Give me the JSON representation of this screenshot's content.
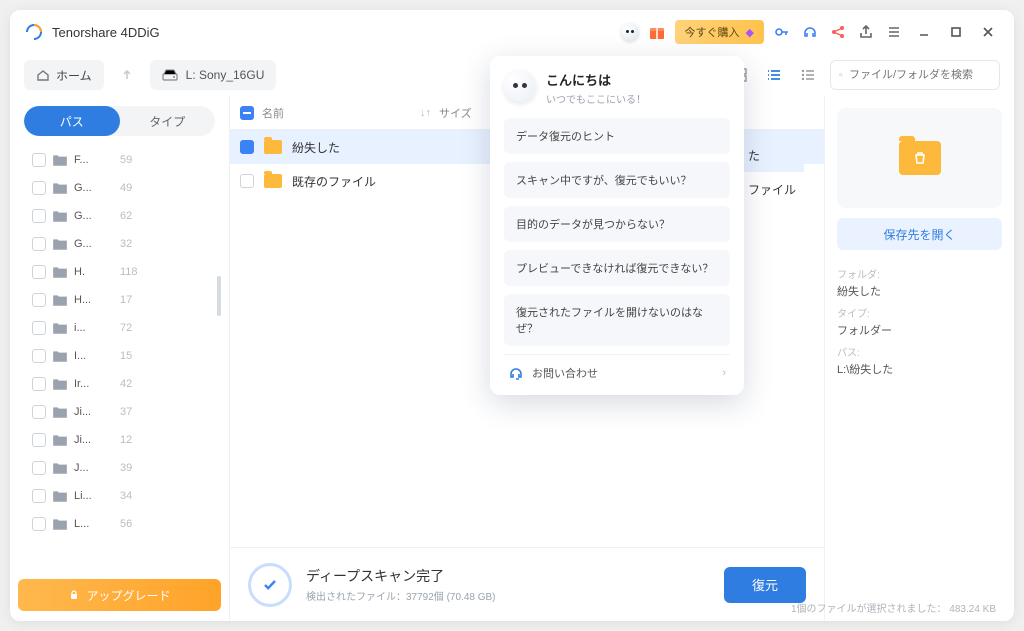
{
  "app": {
    "title": "Tenorshare 4DDiG"
  },
  "titlebar": {
    "buy_label": "今すぐ購入"
  },
  "toolbar": {
    "home_label": "ホーム",
    "drive_label": "L: Sony_16GU",
    "search_placeholder": "ファイル/フォルダを検索"
  },
  "tabs": {
    "path": "パス",
    "type": "タイプ"
  },
  "sidebar": {
    "upgrade_label": "アップグレード",
    "folders": [
      {
        "name": "F...",
        "count": "59"
      },
      {
        "name": "G...",
        "count": "49"
      },
      {
        "name": "G...",
        "count": "62"
      },
      {
        "name": "G...",
        "count": "32"
      },
      {
        "name": "H.",
        "count": "118"
      },
      {
        "name": "H...",
        "count": "17"
      },
      {
        "name": "i...",
        "count": "72"
      },
      {
        "name": "I...",
        "count": "15"
      },
      {
        "name": "Ir...",
        "count": "42"
      },
      {
        "name": "Ji...",
        "count": "37"
      },
      {
        "name": "Ji...",
        "count": "12"
      },
      {
        "name": "J...",
        "count": "39"
      },
      {
        "name": "Li...",
        "count": "34"
      },
      {
        "name": "L...",
        "count": "56"
      }
    ]
  },
  "list": {
    "col_name": "名前",
    "col_size": "サイズ",
    "rows": [
      {
        "name": "紛失した",
        "selected": true
      },
      {
        "name": "既存のファイル",
        "selected": false
      }
    ],
    "ghost": [
      "た",
      "ファイル"
    ]
  },
  "detail": {
    "open_dest": "保存先を開く",
    "folder_label": "フォルダ:",
    "folder_value": "紛失した",
    "type_label": "タイプ:",
    "type_value": "フォルダー",
    "path_label": "パス:",
    "path_value": "L:\\紛失した"
  },
  "status": {
    "title": "ディープスキャン完了",
    "subtitle": "検出されたファイル：37792個 (70.48 GB)",
    "recover_label": "復元",
    "selection_text": "1個のファイルが選択されました： 483.24 KB"
  },
  "popup": {
    "title": "こんにちは",
    "subtitle": "いつでもここにいる！",
    "hints": [
      "データ復元のヒント",
      "スキャン中ですが、復元でもいい？",
      "目的のデータが見つからない？",
      "プレビューできなければ復元できない？",
      "復元されたファイルを開けないのはなぜ？"
    ],
    "contact": "お問い合わせ"
  }
}
